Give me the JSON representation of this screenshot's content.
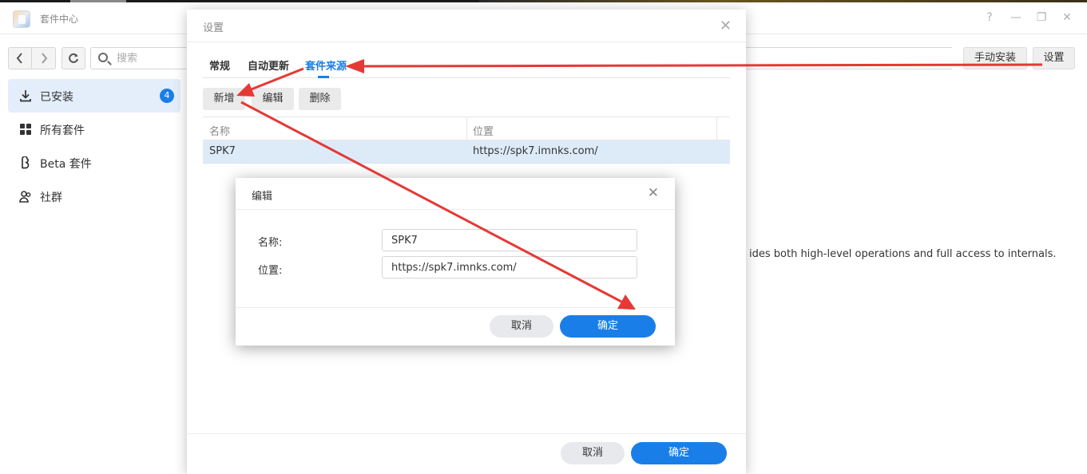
{
  "app": {
    "title": "套件中心",
    "icon": "package-center-icon"
  },
  "window_controls": {
    "help": "?",
    "minimize": "—",
    "restore": "❐",
    "close": "✕"
  },
  "toolbar": {
    "back_icon": "chevron-left-icon",
    "forward_icon": "chevron-right-icon",
    "refresh_icon": "refresh-icon",
    "search_placeholder": "搜索",
    "manual_install_label": "手动安装",
    "settings_label": "设置"
  },
  "sidebar": {
    "items": [
      {
        "label": "已安装",
        "icon": "download-icon",
        "badge": "4",
        "active": true
      },
      {
        "label": "所有套件",
        "icon": "grid-icon"
      },
      {
        "label": "Beta 套件",
        "icon": "beta-icon"
      },
      {
        "label": "社群",
        "icon": "community-icon"
      }
    ]
  },
  "background": {
    "description_fragment": "ides both high-level operations and full access to internals."
  },
  "settings_dialog": {
    "title": "设置",
    "close": "✕",
    "tabs": [
      {
        "label": "常规"
      },
      {
        "label": "自动更新"
      },
      {
        "label": "套件来源",
        "active": true
      }
    ],
    "buttons": {
      "add": "新增",
      "edit": "编辑",
      "delete": "删除"
    },
    "grid": {
      "columns": [
        "名称",
        "位置"
      ],
      "rows": [
        {
          "name": "SPK7",
          "location": "https://spk7.imnks.com/"
        }
      ]
    },
    "footer": {
      "cancel": "取消",
      "ok": "确定"
    }
  },
  "edit_dialog": {
    "title": "编辑",
    "close": "✕",
    "fields": {
      "name_label": "名称:",
      "name_value": "SPK7",
      "location_label": "位置:",
      "location_value": "https://spk7.imnks.com/"
    },
    "footer": {
      "cancel": "取消",
      "ok": "确定"
    }
  },
  "colors": {
    "accent": "#1a7ee8",
    "annotation_arrow": "#e53935",
    "selected_row": "#ddebf9"
  }
}
